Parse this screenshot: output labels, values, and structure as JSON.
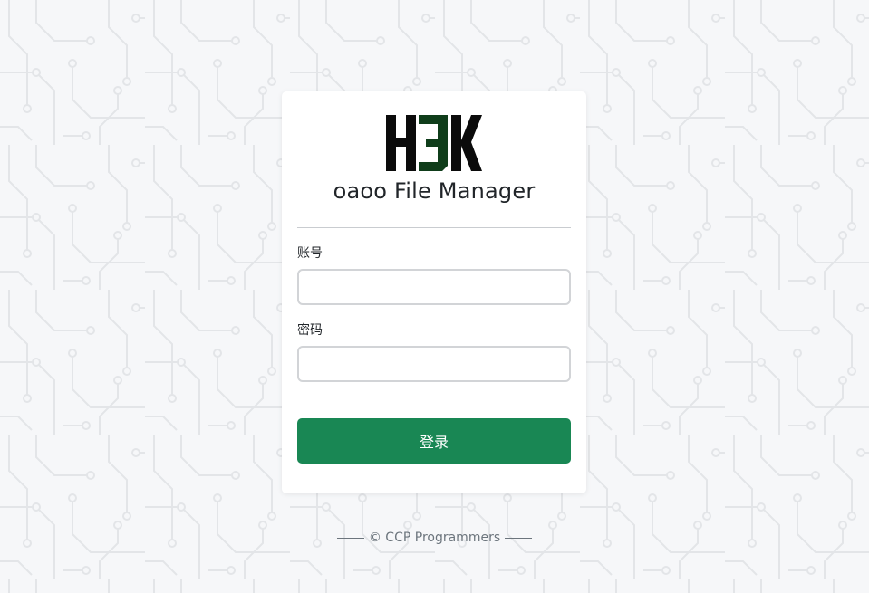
{
  "app": {
    "logo_text": "H3K",
    "title": "oaoo File Manager"
  },
  "form": {
    "username_label": "账号",
    "username_value": "",
    "password_label": "密码",
    "password_value": "",
    "login_label": "登录"
  },
  "footer": {
    "text": "© CCP Programmers"
  },
  "colors": {
    "accent": "#198754",
    "logo_dark": "#0b0b0b",
    "logo_green": "#0f3d1a",
    "background": "#f6f7f9",
    "pattern": "#e6e8eb"
  }
}
